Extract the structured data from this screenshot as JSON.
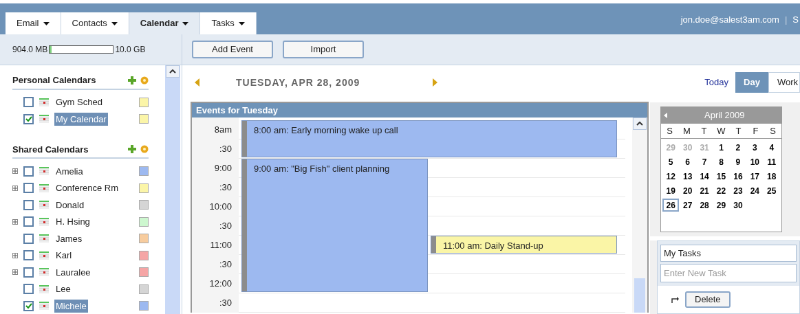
{
  "tabs": [
    {
      "label": "Email",
      "selected": false
    },
    {
      "label": "Contacts",
      "selected": false
    },
    {
      "label": "Calendar",
      "selected": true
    },
    {
      "label": "Tasks",
      "selected": false
    }
  ],
  "account": {
    "email": "jon.doe@salest3am.com",
    "separator": "|",
    "next_link": "S"
  },
  "storage": {
    "used": "904.0 MB",
    "level": 0.03,
    "total": "10.0 GB"
  },
  "toolbar": {
    "buttons": [
      "Add Event",
      "Import"
    ]
  },
  "personal_calendars": {
    "title": "Personal Calendars",
    "items": [
      {
        "name": "Gym Sched",
        "checked": false,
        "selected": false,
        "expandable": false,
        "color": "#fbf5a8"
      },
      {
        "name": "My Calendar",
        "checked": true,
        "selected": true,
        "expandable": false,
        "color": "#fbf5a8"
      }
    ]
  },
  "shared_calendars": {
    "title": "Shared Calendars",
    "items": [
      {
        "name": "Amelia",
        "checked": false,
        "selected": false,
        "expandable": true,
        "color": "#9db9f0"
      },
      {
        "name": "Conference Rm",
        "checked": false,
        "selected": false,
        "expandable": true,
        "color": "#fbf5a8"
      },
      {
        "name": "Donald",
        "checked": false,
        "selected": false,
        "expandable": false,
        "color": "#d5d5d5"
      },
      {
        "name": "H. Hsing",
        "checked": false,
        "selected": false,
        "expandable": true,
        "color": "#cdf7cf"
      },
      {
        "name": "James",
        "checked": false,
        "selected": false,
        "expandable": false,
        "color": "#f7cc9e"
      },
      {
        "name": "Karl",
        "checked": false,
        "selected": false,
        "expandable": true,
        "color": "#f5a5a5"
      },
      {
        "name": "Lauralee",
        "checked": false,
        "selected": false,
        "expandable": true,
        "color": "#f5a5a5"
      },
      {
        "name": "Lee",
        "checked": false,
        "selected": false,
        "expandable": false,
        "color": "#d5d5d5"
      },
      {
        "name": "Michele",
        "checked": true,
        "selected": true,
        "expandable": false,
        "color": "#9db9f0"
      }
    ]
  },
  "date_nav": {
    "date": "TUESDAY, APR 28, 2009"
  },
  "views": {
    "today_link": "Today",
    "items": [
      {
        "label": "Day",
        "selected": true
      },
      {
        "label": "Work",
        "selected": false
      }
    ]
  },
  "day_view": {
    "title": "Events for Tuesday",
    "times": [
      "8am",
      ":30",
      "9:00",
      ":30",
      "10:00",
      ":30",
      "11:00",
      ":30",
      "12:00",
      ":30"
    ],
    "events": [
      {
        "title": "8:00 am: Early morning wake up call",
        "color": "#9db9f0"
      },
      {
        "title": "9:00 am: \"Big Fish\" client planning",
        "color": "#9db9f0"
      },
      {
        "title": "11:00 am: Daily Stand-up",
        "color": "#faf5a6"
      }
    ]
  },
  "mini_calendar": {
    "month": "April 2009",
    "weekdays": [
      "S",
      "M",
      "T",
      "W",
      "T",
      "F",
      "S"
    ],
    "weeks": [
      [
        {
          "day": "29",
          "muted": true,
          "selected": false
        },
        {
          "day": "30",
          "muted": true,
          "selected": false
        },
        {
          "day": "31",
          "muted": true,
          "selected": false
        },
        {
          "day": "1",
          "muted": false,
          "selected": false
        },
        {
          "day": "2",
          "muted": false,
          "selected": false
        },
        {
          "day": "3",
          "muted": false,
          "selected": false
        },
        {
          "day": "4",
          "muted": false,
          "selected": false
        }
      ],
      [
        {
          "day": "5",
          "muted": false,
          "selected": false
        },
        {
          "day": "6",
          "muted": false,
          "selected": false
        },
        {
          "day": "7",
          "muted": false,
          "selected": false
        },
        {
          "day": "8",
          "muted": false,
          "selected": false
        },
        {
          "day": "9",
          "muted": false,
          "selected": false
        },
        {
          "day": "10",
          "muted": false,
          "selected": false
        },
        {
          "day": "11",
          "muted": false,
          "selected": false
        }
      ],
      [
        {
          "day": "12",
          "muted": false,
          "selected": false
        },
        {
          "day": "13",
          "muted": false,
          "selected": false
        },
        {
          "day": "14",
          "muted": false,
          "selected": false
        },
        {
          "day": "15",
          "muted": false,
          "selected": false
        },
        {
          "day": "16",
          "muted": false,
          "selected": false
        },
        {
          "day": "17",
          "muted": false,
          "selected": false
        },
        {
          "day": "18",
          "muted": false,
          "selected": false
        }
      ],
      [
        {
          "day": "19",
          "muted": false,
          "selected": false
        },
        {
          "day": "20",
          "muted": false,
          "selected": false
        },
        {
          "day": "21",
          "muted": false,
          "selected": false
        },
        {
          "day": "22",
          "muted": false,
          "selected": false
        },
        {
          "day": "23",
          "muted": false,
          "selected": false
        },
        {
          "day": "24",
          "muted": false,
          "selected": false
        },
        {
          "day": "25",
          "muted": false,
          "selected": false
        }
      ],
      [
        {
          "day": "26",
          "muted": false,
          "selected": true
        },
        {
          "day": "27",
          "muted": false,
          "selected": false
        },
        {
          "day": "28",
          "muted": false,
          "selected": false
        },
        {
          "day": "29",
          "muted": false,
          "selected": false
        },
        {
          "day": "30",
          "muted": false,
          "selected": false
        }
      ]
    ]
  },
  "tasks": {
    "list": "My Tasks",
    "new_task_placeholder": "Enter New Task",
    "delete_button": "Delete"
  }
}
